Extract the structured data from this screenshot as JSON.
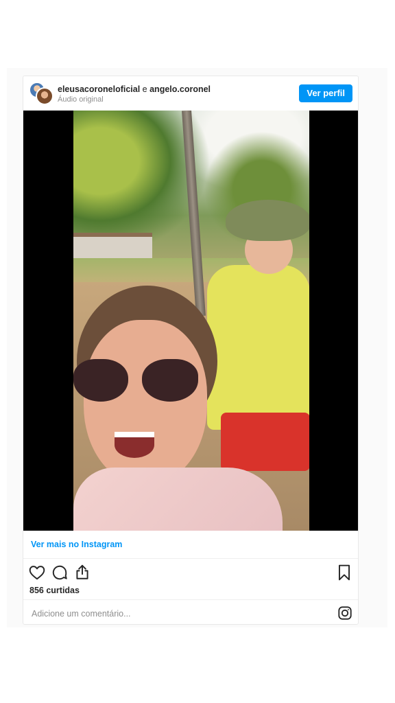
{
  "post": {
    "author_primary": "eleusacoroneloficial",
    "separator": "e",
    "author_secondary": "angelo.coronel",
    "audio_label": "Áudio original",
    "view_profile_label": "Ver perfil",
    "view_more_label": "Ver mais no Instagram",
    "likes_label": "856 curtidas",
    "comment_placeholder": "Adicione um comentário..."
  },
  "icons": {
    "like": "heart-icon",
    "comment": "comment-icon",
    "share": "share-icon",
    "save": "bookmark-icon",
    "brand": "instagram-icon"
  },
  "colors": {
    "accent": "#0095f6",
    "text": "#262626",
    "muted": "#8e8e8e"
  }
}
